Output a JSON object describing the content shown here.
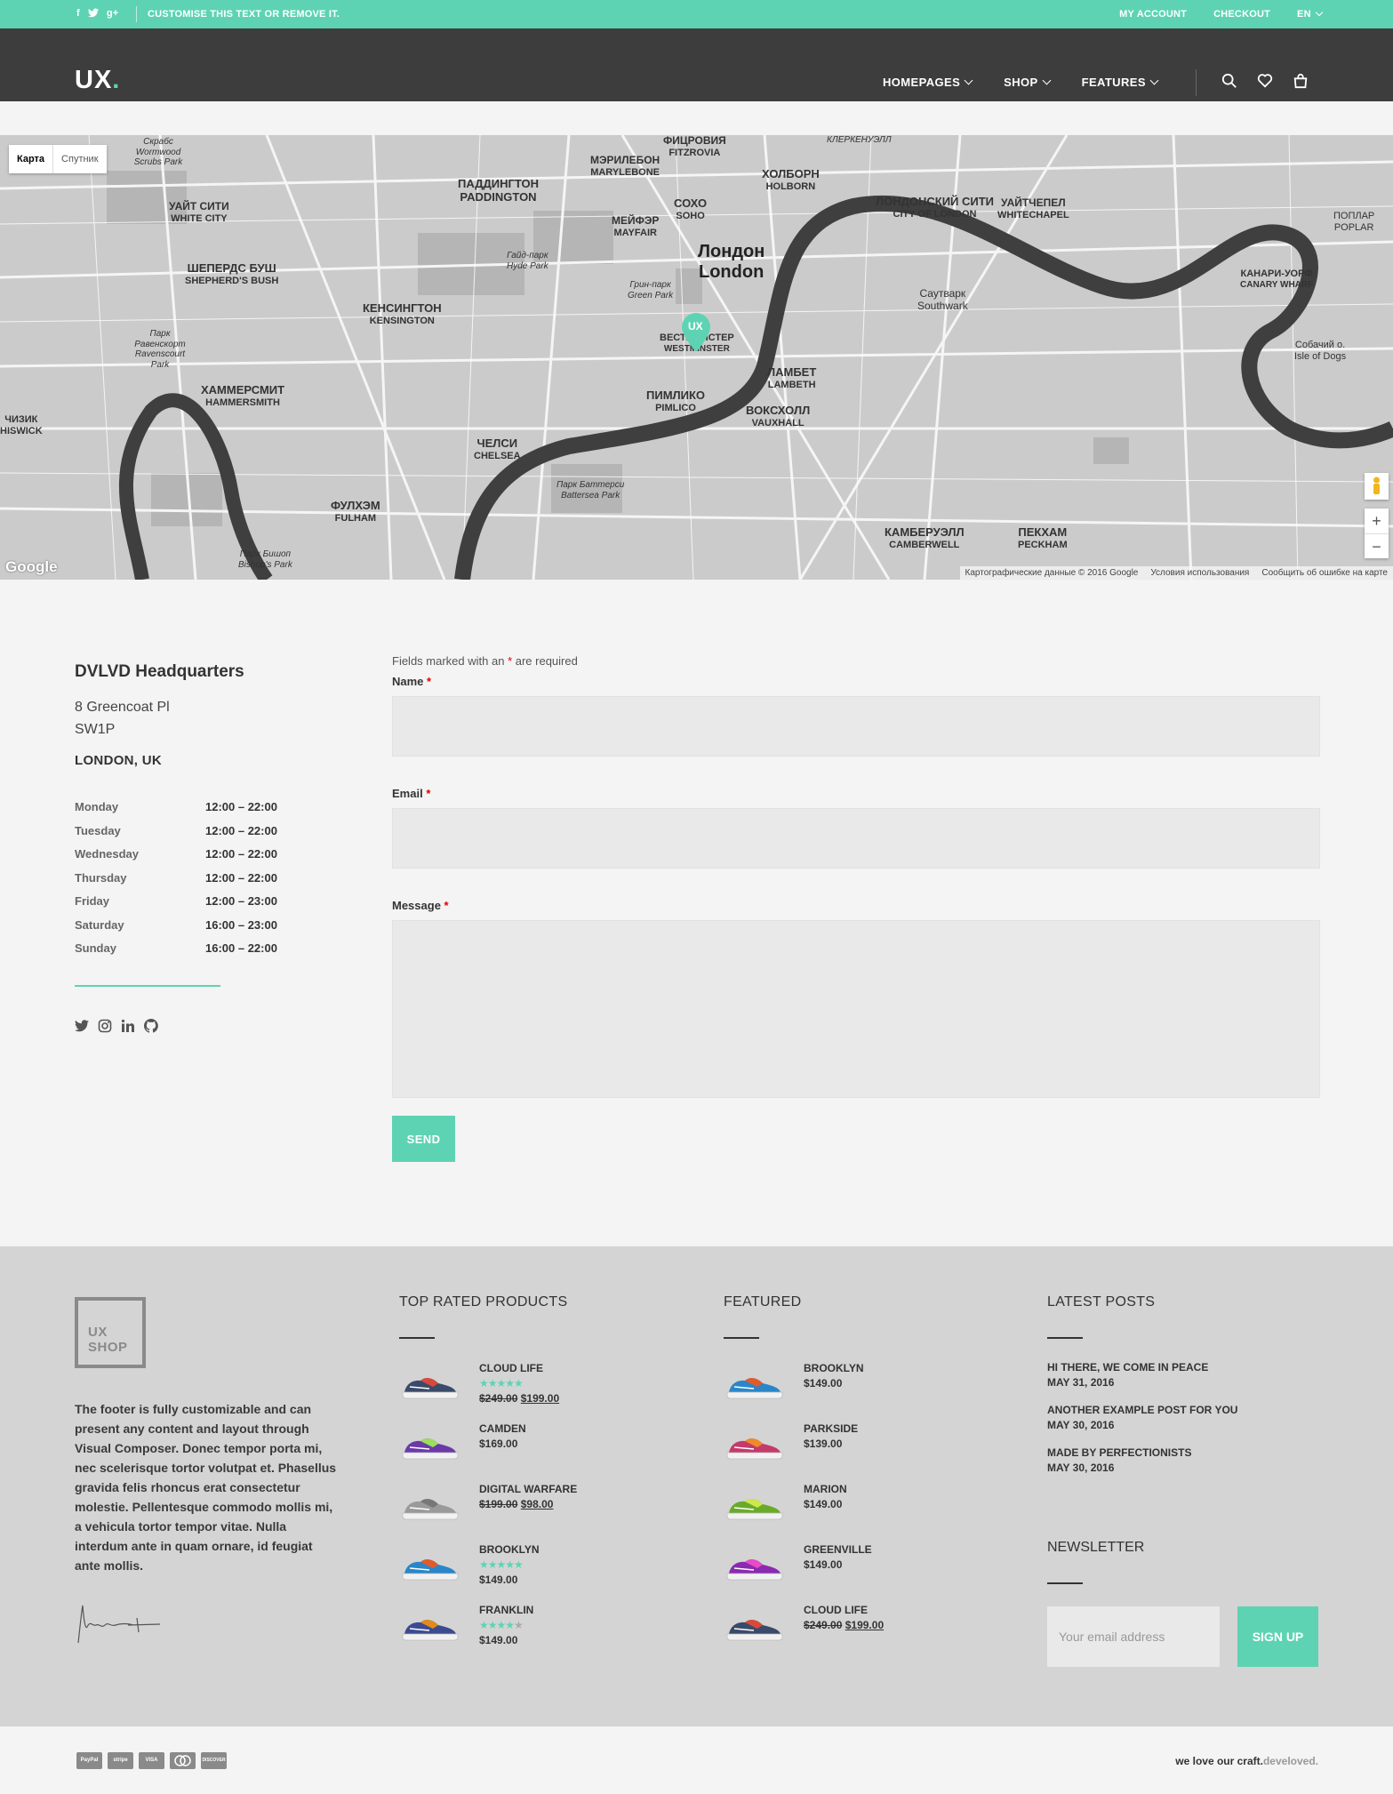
{
  "topbar": {
    "promo": "CUSTOMISE THIS TEXT OR REMOVE IT.",
    "social": [
      {
        "icon": "facebook-icon",
        "glyph": "f"
      },
      {
        "icon": "twitter-icon",
        "glyph": "t"
      },
      {
        "icon": "googleplus-icon",
        "glyph": "g+"
      }
    ],
    "links": [
      "MY ACCOUNT",
      "CHECKOUT",
      "EN"
    ]
  },
  "header": {
    "logo_text": "UX",
    "logo_dot": ".",
    "nav": [
      "HOMEPAGES",
      "SHOP",
      "FEATURES"
    ],
    "icons": [
      "search-icon",
      "heart-icon",
      "bag-icon"
    ]
  },
  "map": {
    "btn_map": "Карта",
    "btn_satellite": "Спутник",
    "labels": [
      {
        "text": "Лондон",
        "sub": "London",
        "cls": "big"
      },
      {
        "text": "Гайд-парк",
        "sub": "Hyde Park",
        "cls": "small"
      },
      {
        "text": "ПАДДИНГТОН",
        "sub": "PADDINGTON",
        "cls": ""
      },
      {
        "text": "ЛОНДОНСКИЙ СИТИ",
        "sub": "CITY OF LONDON",
        "cls": ""
      },
      {
        "text": "ШЕПЕРДС БУШ",
        "sub": "SHEPHERD'S BUSH",
        "cls": ""
      },
      {
        "text": "КЕНСИНГТОН",
        "sub": "KENSINGTON",
        "cls": ""
      },
      {
        "text": "ХАММЕРСМИТ",
        "sub": "HAMMERSMITH",
        "cls": ""
      },
      {
        "text": "ЧЕЛСИ",
        "sub": "CHELSEA",
        "cls": ""
      },
      {
        "text": "ФУЛХЭМ",
        "sub": "FULHAM",
        "cls": ""
      },
      {
        "text": "ПИМЛИКО",
        "sub": "PIMLICO",
        "cls": ""
      },
      {
        "text": "ВОКСХОЛЛ",
        "sub": "VAUXHALL",
        "cls": ""
      },
      {
        "text": "ЛАМБЕТ",
        "sub": "LAMBETH",
        "cls": ""
      },
      {
        "text": "КАМБЕРУЭЛЛ",
        "sub": "CAMBERWELL",
        "cls": ""
      },
      {
        "text": "ПЕКХАМ",
        "sub": "PECKHAM",
        "cls": ""
      },
      {
        "text": "ХОЛБОРН",
        "sub": "HOLBORN",
        "cls": ""
      },
      {
        "text": "СОХО",
        "sub": "SOHO",
        "cls": ""
      },
      {
        "text": "ВЕСТМИНСТЕР",
        "sub": "WESTMINSTER",
        "cls": ""
      },
      {
        "text": "УАЙТ СИТИ",
        "sub": "WHITE CITY",
        "cls": ""
      },
      {
        "text": "УАЙТЧЕПЕЛ",
        "sub": "WHITECHAPEL",
        "cls": ""
      },
      {
        "text": "Саутварк",
        "sub": "Southwark",
        "cls": ""
      },
      {
        "text": "Собачий о.",
        "sub": "Isle of Dogs",
        "cls": ""
      },
      {
        "text": "МЭРИЛЕБОН",
        "sub": "MARYLEBONE",
        "cls": ""
      },
      {
        "text": "МЕЙФЭР",
        "sub": "MAYFAIR",
        "cls": ""
      },
      {
        "text": "ФИЦРОВИЯ",
        "sub": "FITZROVIA",
        "cls": ""
      },
      {
        "text": "Парк Баттерси",
        "sub": "Battersea Park",
        "cls": "small"
      },
      {
        "text": "Грин-парк",
        "sub": "Green Park",
        "cls": "small"
      },
      {
        "text": "Скрабс",
        "sub": "Wormwood Scrubs Park",
        "cls": "small"
      },
      {
        "text": "КАНАРИ-УОРФ",
        "sub": "CANARY WHARF",
        "cls": ""
      },
      {
        "text": "ПОПЛАР",
        "sub": "POPLAR",
        "cls": ""
      },
      {
        "text": "ЧИЗИК",
        "sub": "HISWICK",
        "cls": ""
      },
      {
        "text": "Парк Равенскорт",
        "sub": "Ravenscourt Park",
        "cls": "small"
      },
      {
        "text": "Парк Бишоп",
        "sub": "Bishop's Park",
        "cls": "small"
      },
      {
        "text": "КЛЕРКЕНУЭЛЛ",
        "sub": "",
        "cls": "small"
      }
    ],
    "google": "Google",
    "attribution": [
      "Картографические данные © 2016 Google",
      "Условия использования",
      "Сообщить об ошибке на карте"
    ],
    "pin_text": "UX"
  },
  "contact": {
    "title": "DVLVD Headquarters",
    "address1": "8 Greencoat Pl",
    "address2": "SW1P",
    "city": "LONDON, UK",
    "hours": [
      {
        "day": "Monday",
        "time": "12:00 – 22:00"
      },
      {
        "day": "Tuesday",
        "time": "12:00 – 22:00"
      },
      {
        "day": "Wednesday",
        "time": "12:00 – 22:00"
      },
      {
        "day": "Thursday",
        "time": "12:00 – 22:00"
      },
      {
        "day": "Friday",
        "time": "12:00 – 23:00"
      },
      {
        "day": "Saturday",
        "time": "16:00 – 23:00"
      },
      {
        "day": "Sunday",
        "time": "16:00 – 22:00"
      }
    ],
    "social": [
      "twitter-icon",
      "instagram-icon",
      "linkedin-icon",
      "github-icon"
    ]
  },
  "form": {
    "note_before": "Fields marked with an ",
    "asterisk": "*",
    "note_after": " are required",
    "name_label": "Name",
    "email_label": "Email",
    "message_label": "Message",
    "name_value": "",
    "email_value": "",
    "message_value": "",
    "send": "SEND"
  },
  "footer": {
    "badge_line1": "UX",
    "badge_line2": "SHOP",
    "text": "The footer is fully customizable and can present any content and layout through Visual Composer. Donec tempor porta mi, nec scelerisque tortor volutpat et. Phasellus gravida felis rhoncus erat consectetur molestie. Pellentesque commodo mollis mi, a vehicula tortor tempor vitae. Nulla interdum ante in quam ornare, id feugiat ante mollis.",
    "top_rated_title": "TOP RATED PRODUCTS",
    "top_rated": [
      {
        "name": "CLOUD LIFE",
        "rating": 5,
        "old": "$249.00",
        "price": "$199.00",
        "color": "#3a4a6a",
        "accent": "#d8493a"
      },
      {
        "name": "CAMDEN",
        "rating": 0,
        "old": "",
        "price": "$169.00",
        "color": "#6b3aa8",
        "accent": "#9be05a"
      },
      {
        "name": "DIGITAL WARFARE",
        "rating": 0,
        "old": "$199.00",
        "price": "$98.00",
        "color": "#9a9a9a",
        "accent": "#777"
      },
      {
        "name": "BROOKLYN",
        "rating": 5,
        "old": "",
        "price": "$149.00",
        "color": "#2a86c9",
        "accent": "#e35a2a"
      },
      {
        "name": "FRANKLIN",
        "rating": 4,
        "old": "",
        "price": "$149.00",
        "color": "#3b4b8f",
        "accent": "#e38a1a"
      }
    ],
    "featured_title": "FEATURED",
    "featured": [
      {
        "name": "BROOKLYN",
        "old": "",
        "price": "$149.00",
        "color": "#2a86c9",
        "accent": "#e35a2a"
      },
      {
        "name": "PARKSIDE",
        "old": "",
        "price": "$139.00",
        "color": "#c43a6a",
        "accent": "#f08a2a"
      },
      {
        "name": "MARION",
        "old": "",
        "price": "$149.00",
        "color": "#6aaa2a",
        "accent": "#cde84a"
      },
      {
        "name": "GREENVILLE",
        "old": "",
        "price": "$149.00",
        "color": "#8a2ab0",
        "accent": "#e84ac8"
      },
      {
        "name": "CLOUD LIFE",
        "old": "$249.00",
        "price": "$199.00",
        "color": "#3a4a6a",
        "accent": "#d8493a"
      }
    ],
    "posts_title": "LATEST POSTS",
    "posts": [
      {
        "title": "HI THERE, WE COME IN PEACE",
        "date": "MAY 31, 2016"
      },
      {
        "title": "ANOTHER EXAMPLE POST FOR YOU",
        "date": "MAY 30, 2016"
      },
      {
        "title": "MADE BY PERFECTIONISTS",
        "date": "MAY 30, 2016"
      }
    ],
    "newsletter_title": "NEWSLETTER",
    "newsletter_placeholder": "Your email address",
    "newsletter_button": "SIGN UP"
  },
  "bottom": {
    "payments": [
      "PayPal",
      "stripe",
      "VISA",
      "MC",
      "DISCOVER"
    ],
    "credit_main": "we love our craft.",
    "credit_grey": "develoved."
  },
  "colors": {
    "accent": "#5ed3b3",
    "header": "#3d3d3d",
    "footer": "#d4d4d4"
  }
}
